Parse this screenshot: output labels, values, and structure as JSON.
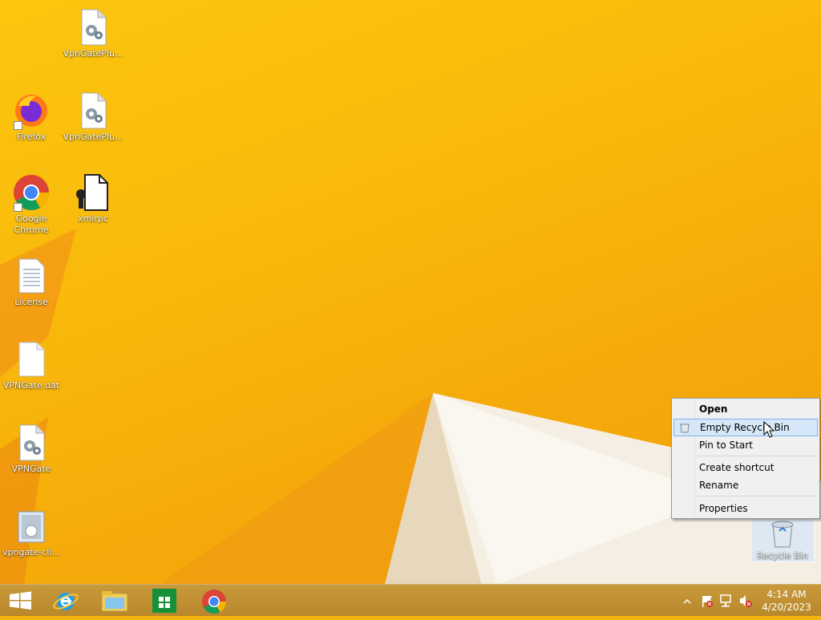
{
  "desktop": {
    "icons": [
      {
        "label": "VpnGatePlu...",
        "icon": "settings-file-icon"
      },
      {
        "label": "Firefox",
        "icon": "firefox-icon"
      },
      {
        "label": "VpnGatePlu...",
        "icon": "settings-file-icon"
      },
      {
        "label": "Google Chrome",
        "icon": "chrome-icon"
      },
      {
        "label": "xmlrpc",
        "icon": "wrench-file-icon"
      },
      {
        "label": "License",
        "icon": "text-file-icon"
      },
      {
        "label": "VPNGate.dat",
        "icon": "blank-file-icon"
      },
      {
        "label": "VPNGate",
        "icon": "settings-file-icon"
      },
      {
        "label": "vpngate-cli...",
        "icon": "installer-icon"
      },
      {
        "label": "Recycle Bin",
        "icon": "recycle-bin-icon"
      }
    ]
  },
  "context_menu": {
    "items": [
      {
        "label": "Open",
        "bold": true
      },
      {
        "label": "Empty Recycle Bin",
        "hovered": true,
        "icon": "empty-bin-icon"
      },
      {
        "label": "Pin to Start"
      },
      {
        "label": "Create shortcut"
      },
      {
        "label": "Rename"
      },
      {
        "label": "Properties"
      }
    ]
  },
  "taskbar": {
    "buttons": [
      {
        "name": "start",
        "icon": "windows-logo-icon"
      },
      {
        "name": "internet-explorer",
        "icon": "ie-icon"
      },
      {
        "name": "file-explorer",
        "icon": "folder-icon"
      },
      {
        "name": "store",
        "icon": "store-icon"
      },
      {
        "name": "chrome",
        "icon": "chrome-icon"
      }
    ],
    "tray": {
      "icons": [
        "chevron-up-icon",
        "action-center-flag-icon",
        "network-icon",
        "volume-muted-icon"
      ],
      "time": "4:14 AM",
      "date": "4/20/2023"
    }
  },
  "colors": {
    "desktop_bg": "#f6b40c",
    "taskbar_bg": "#bf8f33",
    "menu_hover": "#d5e7f8"
  }
}
